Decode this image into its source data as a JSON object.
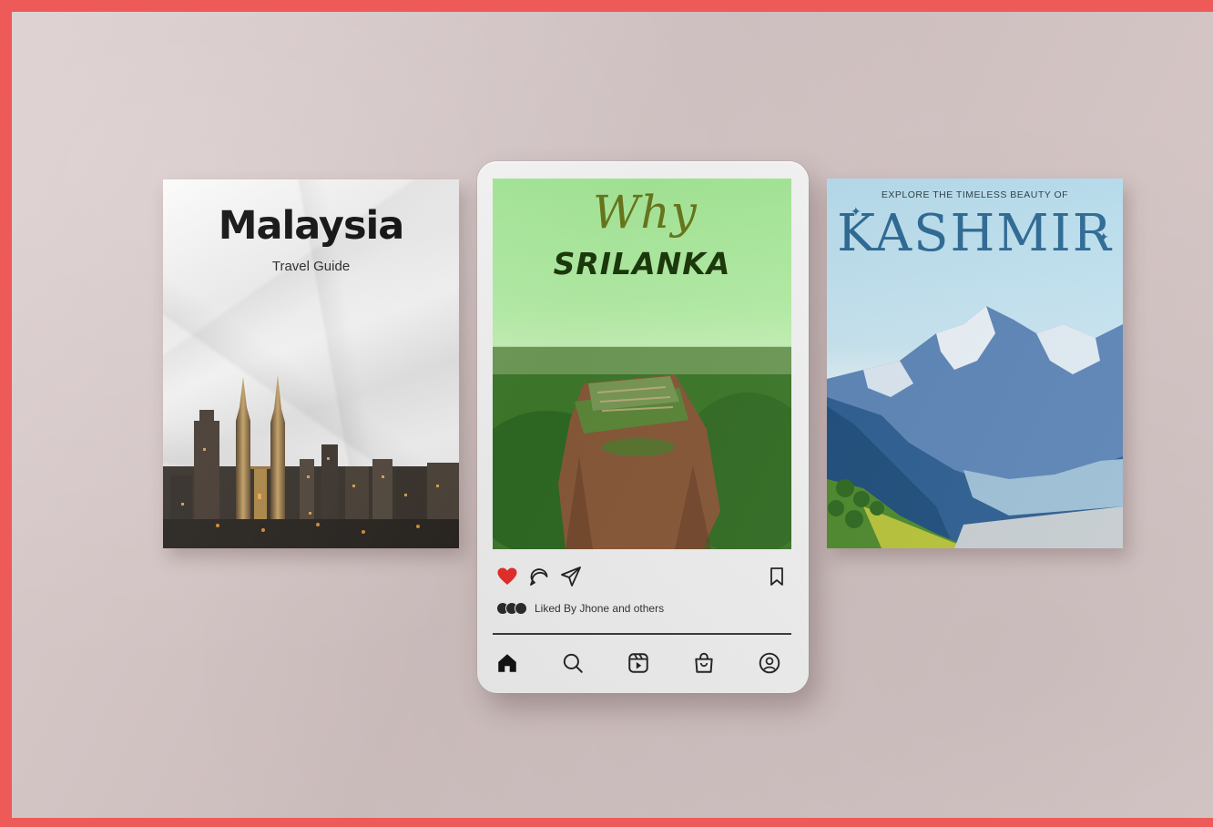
{
  "malaysia_poster": {
    "title": "Malaysia",
    "subtitle": "Travel Guide"
  },
  "instagram_post": {
    "headline_script": "Why",
    "headline_bold": "SRILANKA",
    "liked_text": "Liked By Jhone and others",
    "icons": {
      "like": "heart-icon",
      "comment": "comment-icon",
      "share": "share-icon",
      "save": "bookmark-icon",
      "nav_home": "home-icon",
      "nav_search": "search-icon",
      "nav_reels": "reels-icon",
      "nav_shop": "shop-icon",
      "nav_profile": "profile-icon"
    },
    "colors": {
      "like_heart": "#e8302c",
      "sky_green": "#b8f2aa",
      "headline_dark": "#1c3a0c",
      "script_olive": "#6b7a1c"
    }
  },
  "kashmir_poster": {
    "kicker": "EXPLORE THE TIMELESS BEAUTY OF",
    "title": "KASHMIR"
  },
  "colors": {
    "frame": "#ee5a57",
    "background": "#d7c7c7",
    "kashmir_title": "#2e6b96"
  }
}
